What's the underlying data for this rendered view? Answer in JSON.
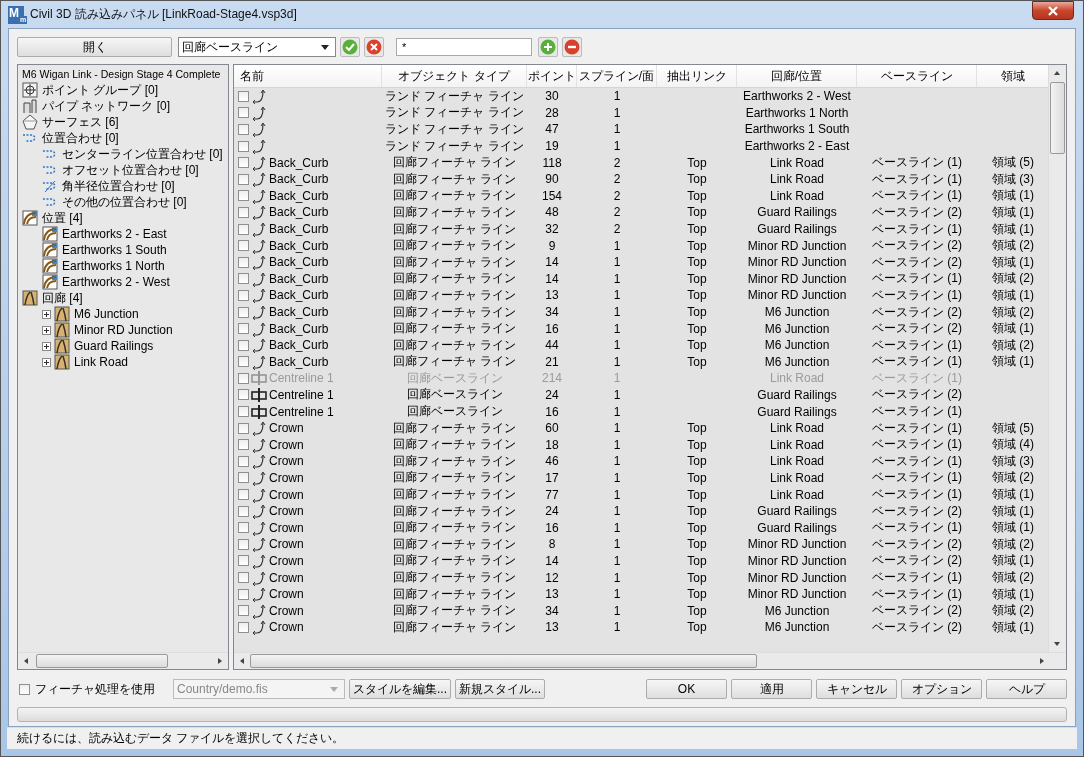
{
  "window": {
    "logo": "M",
    "logo_sub": "m",
    "title": "Civil 3D 読み込みパネル [LinkRoad-Stage4.vsp3d]"
  },
  "toolbar": {
    "open_button": "開く",
    "object_type": {
      "value": "回廊ベースライン"
    },
    "filter": {
      "value": "*"
    }
  },
  "tree": {
    "label": "M6 Wigan Link - Design Stage 4 Complete",
    "children": [
      {
        "kind": "point-group",
        "label": "ポイント グループ [0]"
      },
      {
        "kind": "pipe",
        "label": "パイプ ネットワーク [0]"
      },
      {
        "kind": "surface",
        "label": "サーフェス [6]"
      },
      {
        "kind": "alignment",
        "label": "位置合わせ [0]",
        "children": [
          {
            "kind": "alignment",
            "label": "センターライン位置合わせ [0]"
          },
          {
            "kind": "alignment",
            "label": "オフセット位置合わせ [0]"
          },
          {
            "kind": "curb",
            "label": "角半径位置合わせ [0]"
          },
          {
            "kind": "alignment",
            "label": "その他の位置合わせ [0]"
          }
        ]
      },
      {
        "kind": "site",
        "label": "位置 [4]",
        "children": [
          {
            "kind": "site",
            "label": "Earthworks 2 - East"
          },
          {
            "kind": "site",
            "label": "Earthworks 1 South"
          },
          {
            "kind": "site",
            "label": "Earthworks 1 North"
          },
          {
            "kind": "site",
            "label": "Earthworks 2 - West"
          }
        ]
      },
      {
        "kind": "corridor",
        "label": "回廊 [4]",
        "children": [
          {
            "kind": "corridor",
            "label": "M6 Junction",
            "expanded": false
          },
          {
            "kind": "corridor",
            "label": "Minor RD Junction",
            "expanded": false
          },
          {
            "kind": "corridor",
            "label": "Guard Railings",
            "expanded": false
          },
          {
            "kind": "corridor",
            "label": "Link Road",
            "expanded": false
          }
        ]
      }
    ]
  },
  "table": {
    "columns": [
      "名前",
      "オブジェクト タイプ",
      "ポイント",
      "スプライン/面",
      "抽出リンク",
      "回廊/位置",
      "ベースライン",
      "領域"
    ],
    "rows": [
      {
        "kind": "feature",
        "checked": false,
        "disabled": false,
        "type": "ランド フィーチャ ライン",
        "points": "30",
        "splines": "1",
        "corridor": "Earthworks 2 - West"
      },
      {
        "kind": "feature",
        "checked": false,
        "disabled": false,
        "type": "ランド フィーチャ ライン",
        "points": "28",
        "splines": "1",
        "corridor": "Earthworks 1 North"
      },
      {
        "kind": "feature",
        "checked": false,
        "disabled": false,
        "type": "ランド フィーチャ ライン",
        "points": "47",
        "splines": "1",
        "corridor": "Earthworks 1 South"
      },
      {
        "kind": "feature",
        "checked": false,
        "disabled": false,
        "type": "ランド フィーチャ ライン",
        "points": "19",
        "splines": "1",
        "corridor": "Earthworks 2 - East"
      },
      {
        "kind": "feature",
        "checked": false,
        "disabled": false,
        "name": "Back_Curb",
        "type": "回廊フィーチャ ライン",
        "points": "118",
        "splines": "2",
        "link": "Top",
        "corridor": "Link Road",
        "baseline": "ベースライン (1)",
        "region": "領域 (5)"
      },
      {
        "kind": "feature",
        "checked": false,
        "disabled": false,
        "name": "Back_Curb",
        "type": "回廊フィーチャ ライン",
        "points": "90",
        "splines": "2",
        "link": "Top",
        "corridor": "Link Road",
        "baseline": "ベースライン (1)",
        "region": "領域 (3)"
      },
      {
        "kind": "feature",
        "checked": false,
        "disabled": false,
        "name": "Back_Curb",
        "type": "回廊フィーチャ ライン",
        "points": "154",
        "splines": "2",
        "link": "Top",
        "corridor": "Link Road",
        "baseline": "ベースライン (1)",
        "region": "領域 (1)"
      },
      {
        "kind": "feature",
        "checked": false,
        "disabled": false,
        "name": "Back_Curb",
        "type": "回廊フィーチャ ライン",
        "points": "48",
        "splines": "2",
        "link": "Top",
        "corridor": "Guard Railings",
        "baseline": "ベースライン (2)",
        "region": "領域 (1)"
      },
      {
        "kind": "feature",
        "checked": false,
        "disabled": false,
        "name": "Back_Curb",
        "type": "回廊フィーチャ ライン",
        "points": "32",
        "splines": "2",
        "link": "Top",
        "corridor": "Guard Railings",
        "baseline": "ベースライン (1)",
        "region": "領域 (1)"
      },
      {
        "kind": "feature",
        "checked": false,
        "disabled": false,
        "name": "Back_Curb",
        "type": "回廊フィーチャ ライン",
        "points": "9",
        "splines": "1",
        "link": "Top",
        "corridor": "Minor RD Junction",
        "baseline": "ベースライン (2)",
        "region": "領域 (2)"
      },
      {
        "kind": "feature",
        "checked": false,
        "disabled": false,
        "name": "Back_Curb",
        "type": "回廊フィーチャ ライン",
        "points": "14",
        "splines": "1",
        "link": "Top",
        "corridor": "Minor RD Junction",
        "baseline": "ベースライン (2)",
        "region": "領域 (1)"
      },
      {
        "kind": "feature",
        "checked": false,
        "disabled": false,
        "name": "Back_Curb",
        "type": "回廊フィーチャ ライン",
        "points": "14",
        "splines": "1",
        "link": "Top",
        "corridor": "Minor RD Junction",
        "baseline": "ベースライン (1)",
        "region": "領域 (2)"
      },
      {
        "kind": "feature",
        "checked": false,
        "disabled": false,
        "name": "Back_Curb",
        "type": "回廊フィーチャ ライン",
        "points": "13",
        "splines": "1",
        "link": "Top",
        "corridor": "Minor RD Junction",
        "baseline": "ベースライン (1)",
        "region": "領域 (1)"
      },
      {
        "kind": "feature",
        "checked": false,
        "disabled": false,
        "name": "Back_Curb",
        "type": "回廊フィーチャ ライン",
        "points": "34",
        "splines": "1",
        "link": "Top",
        "corridor": "M6 Junction",
        "baseline": "ベースライン (2)",
        "region": "領域 (2)"
      },
      {
        "kind": "feature",
        "checked": false,
        "disabled": false,
        "name": "Back_Curb",
        "type": "回廊フィーチャ ライン",
        "points": "16",
        "splines": "1",
        "link": "Top",
        "corridor": "M6 Junction",
        "baseline": "ベースライン (2)",
        "region": "領域 (1)"
      },
      {
        "kind": "feature",
        "checked": false,
        "disabled": false,
        "name": "Back_Curb",
        "type": "回廊フィーチャ ライン",
        "points": "44",
        "splines": "1",
        "link": "Top",
        "corridor": "M6 Junction",
        "baseline": "ベースライン (1)",
        "region": "領域 (2)"
      },
      {
        "kind": "feature",
        "checked": false,
        "disabled": false,
        "name": "Back_Curb",
        "type": "回廊フィーチャ ライン",
        "points": "21",
        "splines": "1",
        "link": "Top",
        "corridor": "M6 Junction",
        "baseline": "ベースライン (1)",
        "region": "領域 (1)"
      },
      {
        "kind": "baseline",
        "checked": false,
        "disabled": true,
        "name": "Centreline 1",
        "type": "回廊ベースライン",
        "points": "214",
        "splines": "1",
        "corridor": "Link Road",
        "baseline": "ベースライン (1)"
      },
      {
        "kind": "baseline",
        "checked": false,
        "disabled": false,
        "name": "Centreline 1",
        "type": "回廊ベースライン",
        "points": "24",
        "splines": "1",
        "corridor": "Guard Railings",
        "baseline": "ベースライン (2)"
      },
      {
        "kind": "baseline",
        "checked": false,
        "disabled": false,
        "name": "Centreline 1",
        "type": "回廊ベースライン",
        "points": "16",
        "splines": "1",
        "corridor": "Guard Railings",
        "baseline": "ベースライン (1)"
      },
      {
        "kind": "feature",
        "checked": false,
        "disabled": false,
        "name": "Crown",
        "type": "回廊フィーチャ ライン",
        "points": "60",
        "splines": "1",
        "link": "Top",
        "corridor": "Link Road",
        "baseline": "ベースライン (1)",
        "region": "領域 (5)"
      },
      {
        "kind": "feature",
        "checked": false,
        "disabled": false,
        "name": "Crown",
        "type": "回廊フィーチャ ライン",
        "points": "18",
        "splines": "1",
        "link": "Top",
        "corridor": "Link Road",
        "baseline": "ベースライン (1)",
        "region": "領域 (4)"
      },
      {
        "kind": "feature",
        "checked": false,
        "disabled": false,
        "name": "Crown",
        "type": "回廊フィーチャ ライン",
        "points": "46",
        "splines": "1",
        "link": "Top",
        "corridor": "Link Road",
        "baseline": "ベースライン (1)",
        "region": "領域 (3)"
      },
      {
        "kind": "feature",
        "checked": false,
        "disabled": false,
        "name": "Crown",
        "type": "回廊フィーチャ ライン",
        "points": "17",
        "splines": "1",
        "link": "Top",
        "corridor": "Link Road",
        "baseline": "ベースライン (1)",
        "region": "領域 (2)"
      },
      {
        "kind": "feature",
        "checked": false,
        "disabled": false,
        "name": "Crown",
        "type": "回廊フィーチャ ライン",
        "points": "77",
        "splines": "1",
        "link": "Top",
        "corridor": "Link Road",
        "baseline": "ベースライン (1)",
        "region": "領域 (1)"
      },
      {
        "kind": "feature",
        "checked": false,
        "disabled": false,
        "name": "Crown",
        "type": "回廊フィーチャ ライン",
        "points": "24",
        "splines": "1",
        "link": "Top",
        "corridor": "Guard Railings",
        "baseline": "ベースライン (2)",
        "region": "領域 (1)"
      },
      {
        "kind": "feature",
        "checked": false,
        "disabled": false,
        "name": "Crown",
        "type": "回廊フィーチャ ライン",
        "points": "16",
        "splines": "1",
        "link": "Top",
        "corridor": "Guard Railings",
        "baseline": "ベースライン (1)",
        "region": "領域 (1)"
      },
      {
        "kind": "feature",
        "checked": false,
        "disabled": false,
        "name": "Crown",
        "type": "回廊フィーチャ ライン",
        "points": "8",
        "splines": "1",
        "link": "Top",
        "corridor": "Minor RD Junction",
        "baseline": "ベースライン (2)",
        "region": "領域 (2)"
      },
      {
        "kind": "feature",
        "checked": false,
        "disabled": false,
        "name": "Crown",
        "type": "回廊フィーチャ ライン",
        "points": "14",
        "splines": "1",
        "link": "Top",
        "corridor": "Minor RD Junction",
        "baseline": "ベースライン (2)",
        "region": "領域 (1)"
      },
      {
        "kind": "feature",
        "checked": false,
        "disabled": false,
        "name": "Crown",
        "type": "回廊フィーチャ ライン",
        "points": "12",
        "splines": "1",
        "link": "Top",
        "corridor": "Minor RD Junction",
        "baseline": "ベースライン (1)",
        "region": "領域 (2)"
      },
      {
        "kind": "feature",
        "checked": false,
        "disabled": false,
        "name": "Crown",
        "type": "回廊フィーチャ ライン",
        "points": "13",
        "splines": "1",
        "link": "Top",
        "corridor": "Minor RD Junction",
        "baseline": "ベースライン (1)",
        "region": "領域 (1)"
      },
      {
        "kind": "feature",
        "checked": false,
        "disabled": false,
        "name": "Crown",
        "type": "回廊フィーチャ ライン",
        "points": "34",
        "splines": "1",
        "link": "Top",
        "corridor": "M6 Junction",
        "baseline": "ベースライン (2)",
        "region": "領域 (2)"
      },
      {
        "kind": "feature",
        "checked": false,
        "disabled": false,
        "name": "Crown",
        "type": "回廊フィーチャ ライン",
        "points": "13",
        "splines": "1",
        "link": "Top",
        "corridor": "M6 Junction",
        "baseline": "ベースライン (2)",
        "region": "領域 (1)"
      }
    ]
  },
  "options": {
    "use_feature_processing": {
      "label": "フィーチャ処理を使用",
      "checked": false
    },
    "style_file": {
      "value": "Country/demo.fis",
      "disabled": true
    },
    "edit_style_button": "スタイルを編集...",
    "new_style_button": "新規スタイル..."
  },
  "buttons": [
    "OK",
    "適用",
    "キャンセル",
    "オプション",
    "ヘルプ"
  ],
  "progress": {
    "level": 0
  },
  "status_bar": "続けるには、読み込むデータ ファイルを選択してください。"
}
